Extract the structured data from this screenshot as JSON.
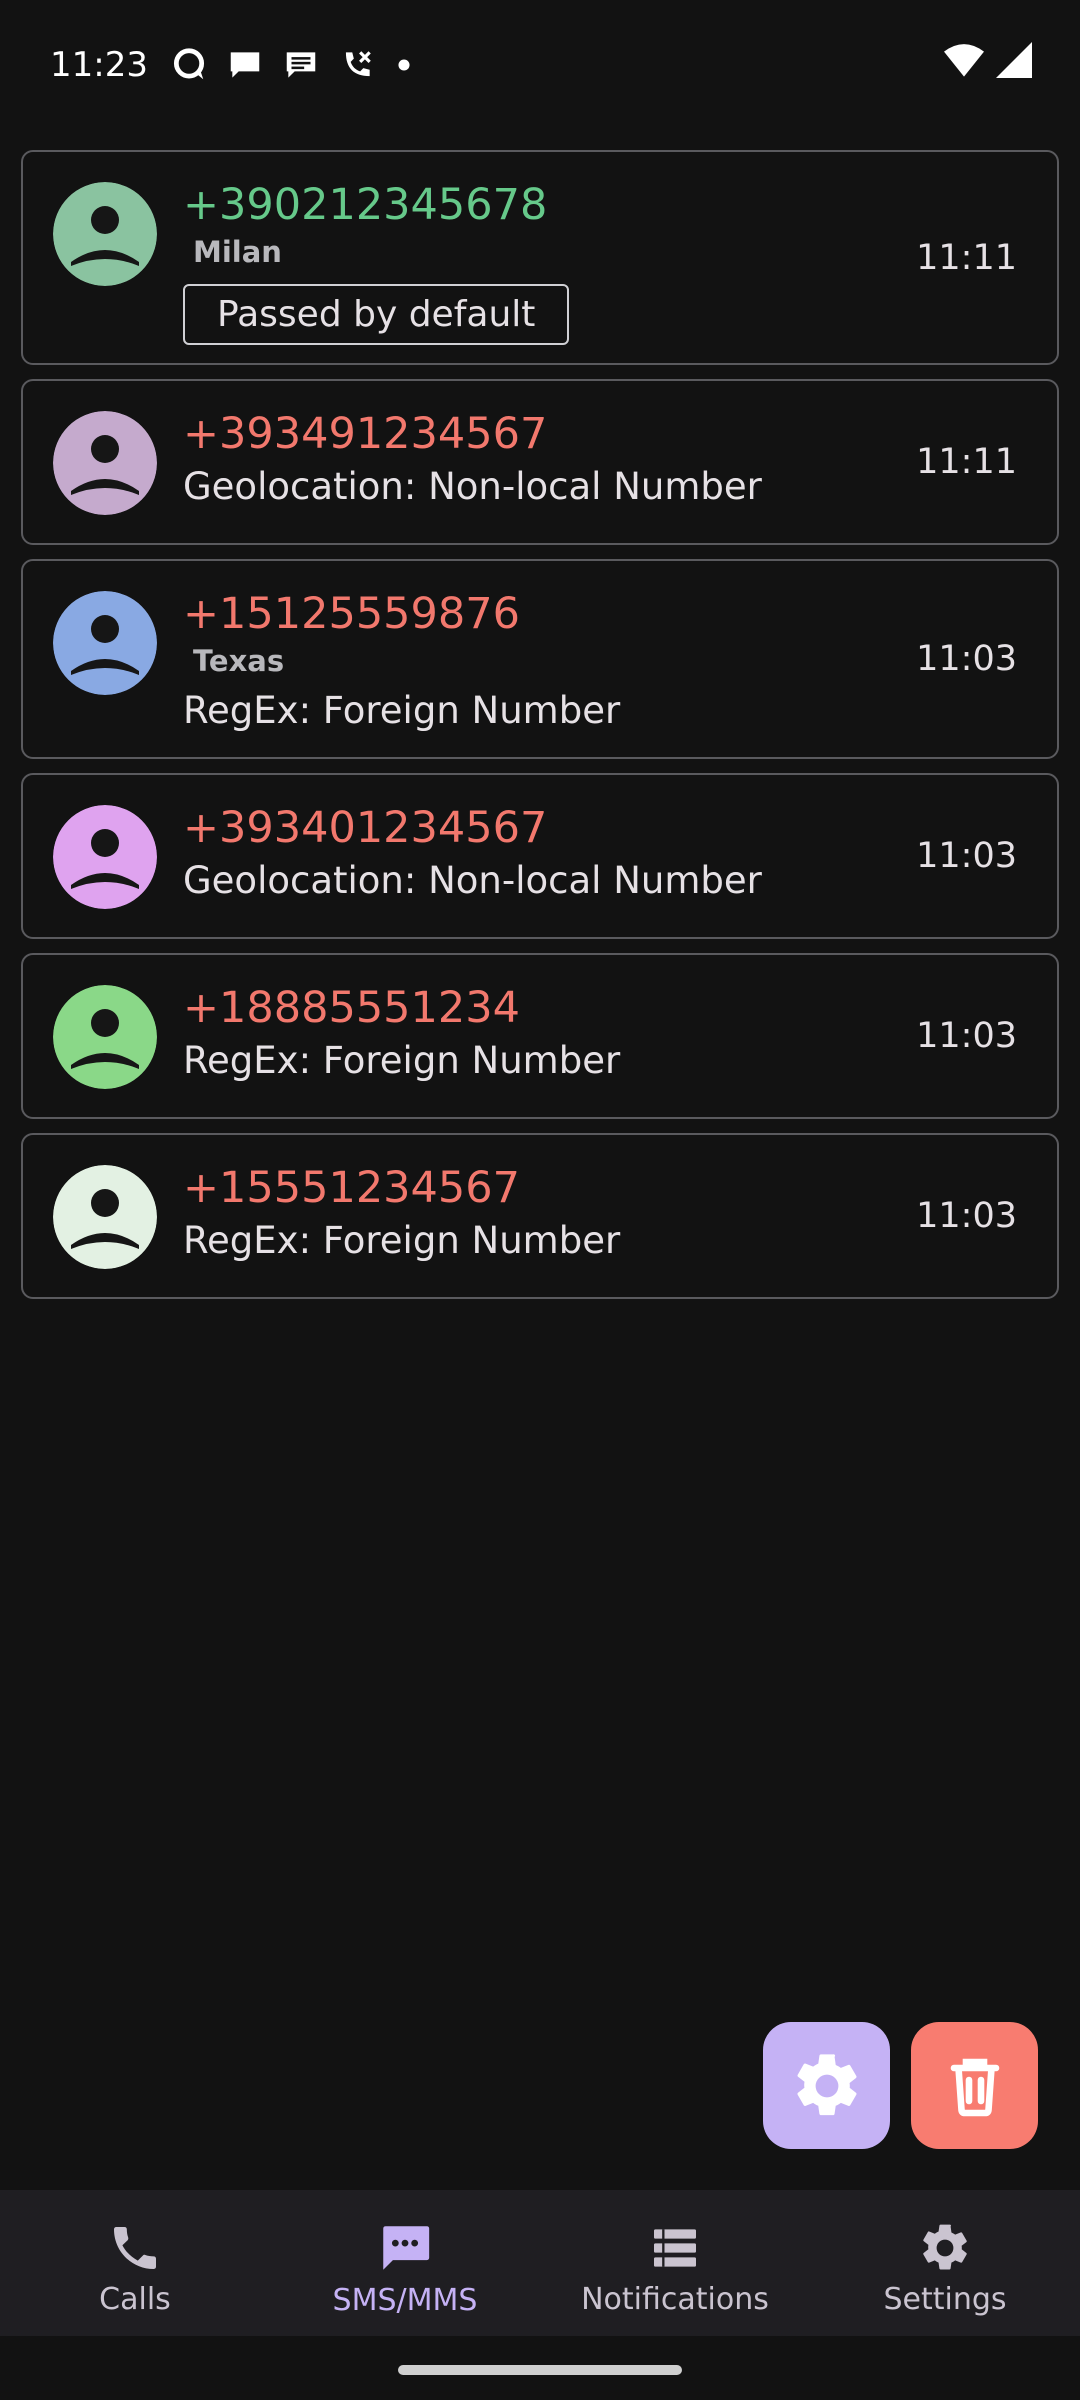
{
  "status_bar": {
    "time": "11:23"
  },
  "entries": [
    {
      "number": "+390212345678",
      "location": "Milan",
      "reason": "",
      "badge": "Passed by default",
      "time": "11:11",
      "status": "passed",
      "avatar_color": "#8ac3a0"
    },
    {
      "number": "+393491234567",
      "location": "",
      "reason": "Geolocation: Non-local Number",
      "badge": "",
      "time": "11:11",
      "status": "blocked",
      "avatar_color": "#c5aacd"
    },
    {
      "number": "+15125559876",
      "location": "Texas",
      "reason": "RegEx: Foreign Number",
      "badge": "",
      "time": "11:03",
      "status": "blocked",
      "avatar_color": "#89a9e3"
    },
    {
      "number": "+393401234567",
      "location": "",
      "reason": "Geolocation: Non-local Number",
      "badge": "",
      "time": "11:03",
      "status": "blocked",
      "avatar_color": "#dfa3ef"
    },
    {
      "number": "+18885551234",
      "location": "",
      "reason": "RegEx: Foreign Number",
      "badge": "",
      "time": "11:03",
      "status": "blocked",
      "avatar_color": "#8ad888"
    },
    {
      "number": "+15551234567",
      "location": "",
      "reason": "RegEx: Foreign Number",
      "badge": "",
      "time": "11:03",
      "status": "blocked",
      "avatar_color": "#e3f1e3"
    }
  ],
  "fabs": {
    "settings_icon": "gear-icon",
    "delete_icon": "trash-icon"
  },
  "nav": {
    "items": [
      {
        "label": "Calls",
        "icon": "phone-icon",
        "active": false
      },
      {
        "label": "SMS/MMS",
        "icon": "message-icon",
        "active": true
      },
      {
        "label": "Notifications",
        "icon": "list-icon",
        "active": false
      },
      {
        "label": "Settings",
        "icon": "gear-icon",
        "active": false
      }
    ]
  },
  "colors": {
    "blocked_number": "#f2786d",
    "passed_number": "#66c98a",
    "accent": "#c5b2f5",
    "delete": "#f87c70"
  }
}
